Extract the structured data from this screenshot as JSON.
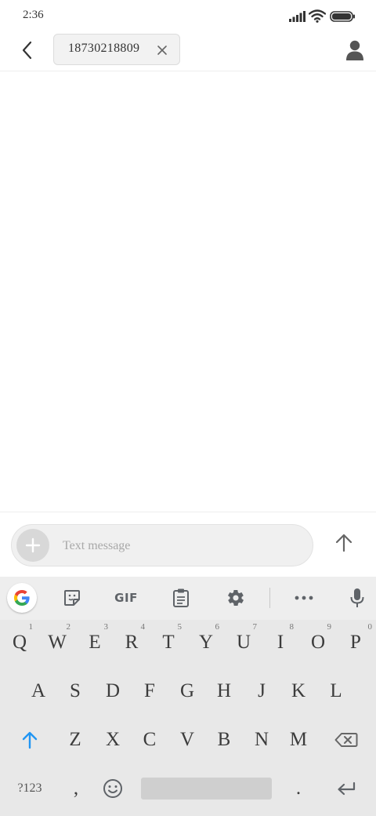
{
  "status_bar": {
    "time": "2:36",
    "icons": [
      "signal-icon",
      "wifi-icon",
      "battery-icon"
    ]
  },
  "top_bar": {
    "back_icon": "chevron-left-icon",
    "recipient": "18730218809",
    "remove_icon": "close-icon",
    "contact_icon": "person-icon"
  },
  "compose": {
    "placeholder": "Text message",
    "value": "",
    "attach_icon": "plus-icon",
    "send_icon": "arrow-up-icon"
  },
  "keyboard": {
    "toolbar": {
      "gif_label": "GIF",
      "icons": [
        "google-icon",
        "sticker-icon",
        "clipboard-icon",
        "gear-icon",
        "more-icon",
        "mic-icon"
      ]
    },
    "row1": [
      {
        "label": "Q",
        "hint": "1"
      },
      {
        "label": "W",
        "hint": "2"
      },
      {
        "label": "E",
        "hint": "3"
      },
      {
        "label": "R",
        "hint": "4"
      },
      {
        "label": "T",
        "hint": "5"
      },
      {
        "label": "Y",
        "hint": "6"
      },
      {
        "label": "U",
        "hint": "7"
      },
      {
        "label": "I",
        "hint": "8"
      },
      {
        "label": "O",
        "hint": "9"
      },
      {
        "label": "P",
        "hint": "0"
      }
    ],
    "row2": [
      "A",
      "S",
      "D",
      "F",
      "G",
      "H",
      "J",
      "K",
      "L"
    ],
    "row3": [
      "Z",
      "X",
      "C",
      "V",
      "B",
      "N",
      "M"
    ],
    "bottom": {
      "symbols_label": "?123",
      "comma": ",",
      "period": "."
    },
    "colors": {
      "shift_active": "#2196f3",
      "background": "#e8e8e8"
    }
  }
}
